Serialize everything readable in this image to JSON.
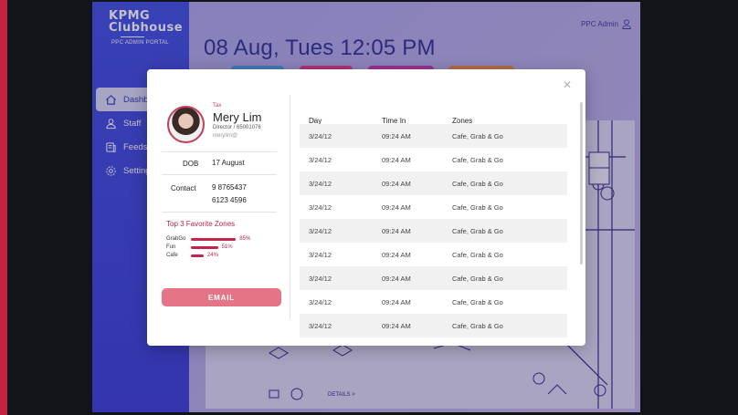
{
  "app": {
    "logo_line1": "KPMG",
    "logo_line2": "Clubhouse",
    "logo_sub": "PPC ADMIN PORTAL",
    "datetime": "08 Aug, Tues 12:05  PM",
    "user": "PPC Admin",
    "nav": [
      {
        "label": "Dashboard",
        "icon": "home-icon"
      },
      {
        "label": "Staff",
        "icon": "user-icon"
      },
      {
        "label": "Feeds",
        "icon": "feeds-icon"
      },
      {
        "label": "Settings",
        "icon": "gear-icon"
      }
    ],
    "map_footer": "DETAILS >"
  },
  "modal": {
    "profile": {
      "dept": "Tax",
      "name": "Mery Lim",
      "role": "Director / 65001076",
      "email": "merylim@",
      "dob_label": "DOB",
      "dob": "17 August",
      "contact_label": "Contact",
      "contact1": "9 8765437",
      "contact2": "6123 4596"
    },
    "favorites": {
      "title": "Top 3 Favorite Zones",
      "items": [
        {
          "name": "GrabGo",
          "value": 85,
          "label": "85%"
        },
        {
          "name": "Fun",
          "value": 51,
          "label": "51%"
        },
        {
          "name": "Cafe",
          "value": 24,
          "label": "24%"
        }
      ]
    },
    "email_button": "EMAIL",
    "table": {
      "headers": [
        "Day",
        "Time In",
        "Zones"
      ],
      "rows": [
        [
          "3/24/12",
          "09:24 AM",
          "Cafe, Grab & Go"
        ],
        [
          "3/24/12",
          "09:24 AM",
          "Cafe, Grab & Go"
        ],
        [
          "3/24/12",
          "09:24 AM",
          "Cafe, Grab & Go"
        ],
        [
          "3/24/12",
          "09:24 AM",
          "Cafe, Grab & Go"
        ],
        [
          "3/24/12",
          "09:24 AM",
          "Cafe, Grab & Go"
        ],
        [
          "3/24/12",
          "09:24 AM",
          "Cafe, Grab & Go"
        ],
        [
          "3/24/12",
          "09:24 AM",
          "Cafe, Grab & Go"
        ],
        [
          "3/24/12",
          "09:24 AM",
          "Cafe, Grab & Go"
        ],
        [
          "3/24/12",
          "09:24 AM",
          "Cafe, Grab & Go"
        ]
      ]
    }
  },
  "colors": {
    "accent": "#c1244c",
    "sidebar": "#3e4fe0",
    "button": "#e57586"
  }
}
